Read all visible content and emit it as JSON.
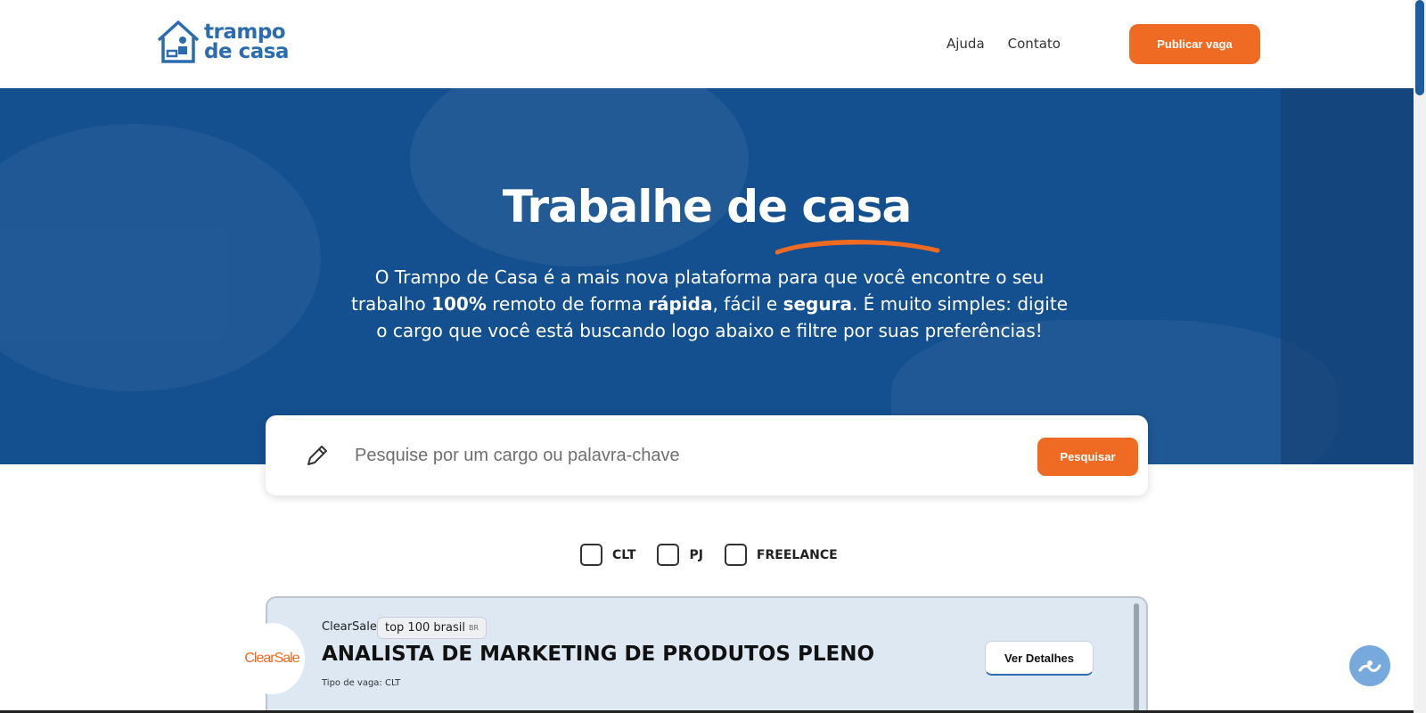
{
  "header": {
    "logo_line1": "trampo",
    "logo_line2": "de casa",
    "nav": [
      {
        "label": "Ajuda"
      },
      {
        "label": "Contato"
      }
    ],
    "publish_label": "Publicar vaga"
  },
  "hero": {
    "title": "Trabalhe de casa",
    "desc_part1": "O Trampo de Casa é a mais nova plataforma para que você encontre o seu trabalho ",
    "desc_bold1": "100%",
    "desc_part2": " remoto de forma ",
    "desc_bold2": "rápida",
    "desc_part3": ", fácil e ",
    "desc_bold3": "segura",
    "desc_part4": ". É muito simples: digite o cargo que você está buscando logo abaixo e filtre por suas preferências!"
  },
  "search": {
    "placeholder": "Pesquise por um cargo ou palavra-chave",
    "value": "",
    "button_label": "Pesquisar"
  },
  "filters": [
    {
      "label": "CLT",
      "checked": false
    },
    {
      "label": "PJ",
      "checked": false
    },
    {
      "label": "FREELANCE",
      "checked": false
    }
  ],
  "job": {
    "company": "ClearSale",
    "company_logo_text": "ClearSale",
    "badge": "top 100 brasil",
    "badge_suffix": "BR",
    "title": "ANALISTA DE MARKETING DE PRODUTOS PLENO",
    "type": "Tipo de vaga: CLT",
    "details_label": "Ver Detalhes"
  },
  "colors": {
    "brand_blue": "#14508f",
    "accent_orange": "#ef6a22",
    "logo_blue": "#2b6cb0"
  },
  "icons": {
    "search_field": "pencil-icon",
    "floating": "accessibility-icon"
  }
}
